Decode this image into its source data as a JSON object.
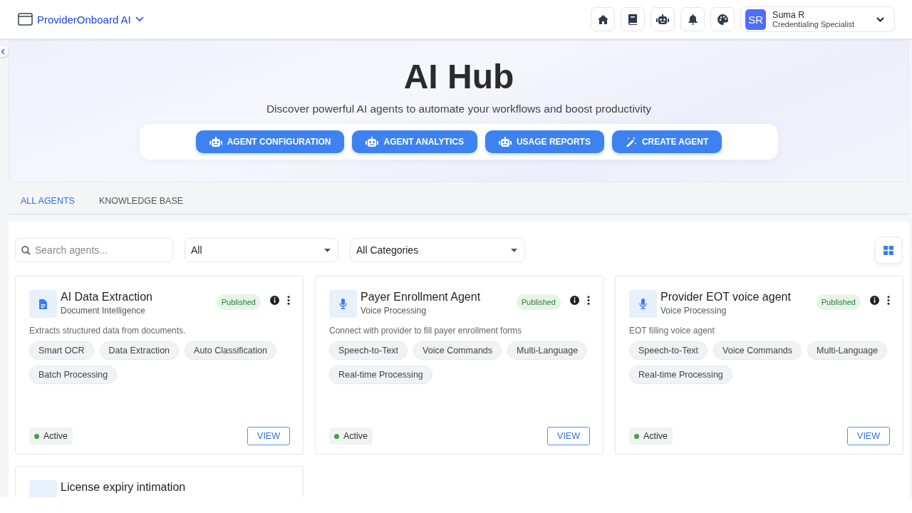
{
  "app": {
    "title": "ProviderOnboard AI"
  },
  "user": {
    "initials": "SR",
    "name": "Suma R",
    "role": "Credentialing Specialist"
  },
  "hero": {
    "title": "AI Hub",
    "subtitle": "Discover powerful AI agents to automate your workflows and boost productivity",
    "actions": [
      {
        "label": "AGENT CONFIGURATION",
        "kind": "robot"
      },
      {
        "label": "AGENT ANALYTICS",
        "kind": "robot"
      },
      {
        "label": "USAGE REPORTS",
        "kind": "robot"
      },
      {
        "label": "CREATE AGENT",
        "kind": "wand"
      }
    ]
  },
  "tabs": [
    {
      "label": "ALL AGENTS",
      "selected": true
    },
    {
      "label": "KNOWLEDGE BASE",
      "selected": false
    }
  ],
  "filters": {
    "search_placeholder": "Search agents...",
    "status": "All",
    "category": "All Categories"
  },
  "agents": [
    {
      "name": "AI Data Extraction",
      "category": "Document Intelligence",
      "kind": "document",
      "badge": "Published",
      "description": "Extracts structured data from documents.",
      "tags": [
        "Smart OCR",
        "Data Extraction",
        "Auto Classification",
        "Batch Processing"
      ],
      "status": "Active",
      "action": "VIEW"
    },
    {
      "name": "Payer Enrollment Agent",
      "category": "Voice Processing",
      "kind": "voice",
      "badge": "Published",
      "description": "Connect with provider to fill payer enrollment forms",
      "tags": [
        "Speech-to-Text",
        "Voice Commands",
        "Multi-Language",
        "Real-time Processing"
      ],
      "status": "Active",
      "action": "VIEW"
    },
    {
      "name": "Provider EOT voice agent",
      "category": "Voice Processing",
      "kind": "voice",
      "badge": "Published",
      "description": "EOT filling voice agent",
      "tags": [
        "Speech-to-Text",
        "Voice Commands",
        "Multi-Language",
        "Real-time Processing"
      ],
      "status": "Active",
      "action": "VIEW"
    },
    {
      "name": "License expiry intimation"
    }
  ]
}
